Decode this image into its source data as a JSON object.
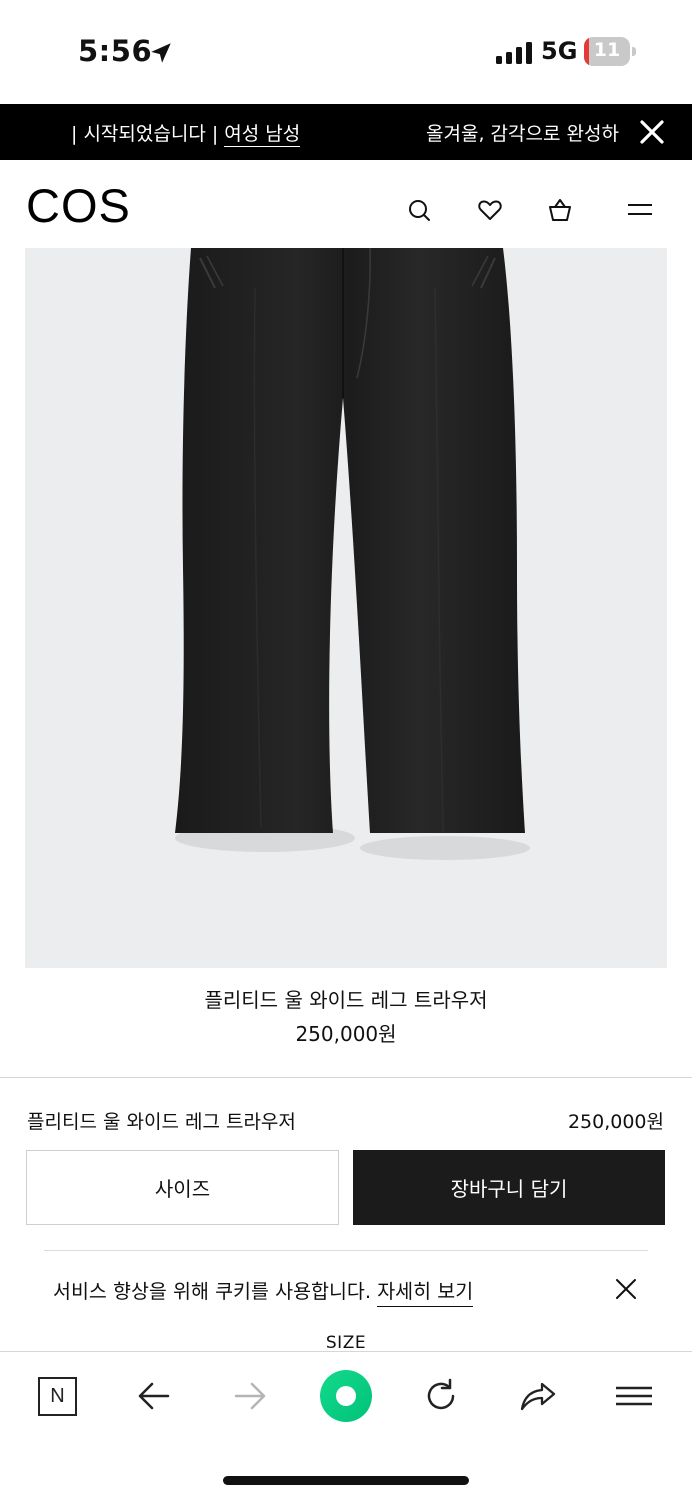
{
  "status_bar": {
    "time": "5:56",
    "network": "5G",
    "battery_level": "11",
    "battery_fraction": 0.11,
    "icons": [
      "location-arrow-icon",
      "signal-bars-icon",
      "battery-icon"
    ]
  },
  "announcement": {
    "left_text": "| 시작되었습니다 | ",
    "link_text": "여성 남성",
    "right_text": "올겨울, 감각으로 완성하",
    "close_icon": "close-icon"
  },
  "header": {
    "logo": "COS",
    "icons": [
      "search-icon",
      "heart-icon",
      "bag-icon",
      "menu-icon"
    ]
  },
  "product": {
    "name": "플리티드 울 와이드 레그 트라우저",
    "price": "250,000원"
  },
  "sticky_bar": {
    "name": "플리티드 울 와이드 레그 트라우저",
    "price": "250,000원",
    "size_button": "사이즈",
    "cart_button": "장바구니 담기"
  },
  "cookie": {
    "text": "서비스 향상을 위해 쿠키를 사용합니다. ",
    "link": "자세히 보기"
  },
  "size_heading": "SIZE",
  "browser_toolbar": {
    "n_label": "N",
    "icons": [
      "n-icon",
      "back-arrow-icon",
      "forward-arrow-icon",
      "green-dot-icon",
      "reload-icon",
      "share-icon",
      "hamburger-icon"
    ]
  },
  "colors": {
    "announcement_bg": "#000000",
    "cart_button_bg": "#1b1b1b",
    "image_bg": "#ecedef",
    "battery_low": "#e53935",
    "green_button": "#00c27a"
  }
}
